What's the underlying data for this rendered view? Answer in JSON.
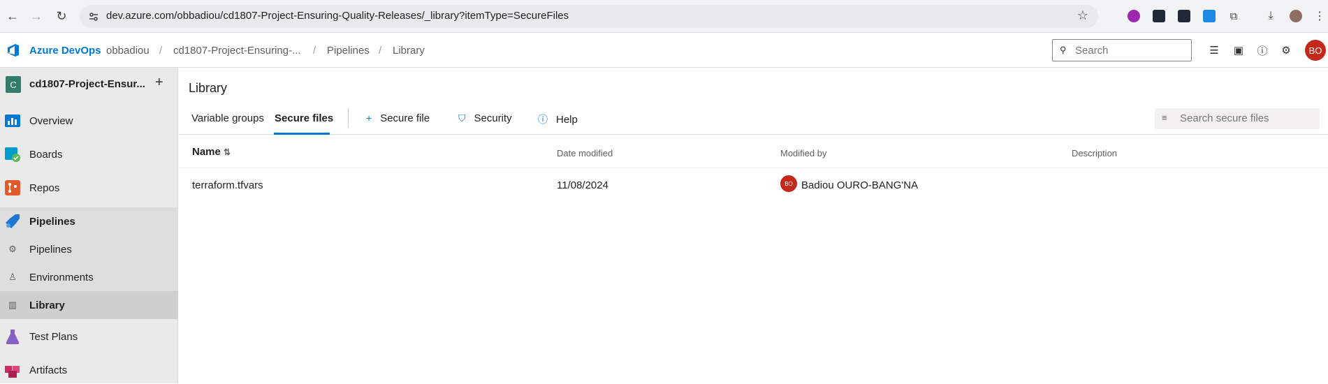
{
  "browser": {
    "url": "dev.azure.com/obbadiou/cd1807-Project-Ensuring-Quality-Releases/_library?itemType=SecureFiles"
  },
  "header": {
    "brand": "Azure DevOps",
    "breadcrumb": [
      "obbadiou",
      "cd1807-Project-Ensuring-...",
      "Pipelines",
      "Library"
    ],
    "search_placeholder": "Search",
    "user_initials": "BO"
  },
  "sidebar": {
    "project_initial": "C",
    "project_name": "cd1807-Project-Ensur...",
    "items": [
      {
        "label": "Overview",
        "icon": "overview-icon",
        "color": "#0078d4"
      },
      {
        "label": "Boards",
        "icon": "boards-icon",
        "color": "#009ccc"
      },
      {
        "label": "Repos",
        "icon": "repos-icon",
        "color": "#e05a2b"
      },
      {
        "label": "Pipelines",
        "icon": "pipelines-icon",
        "color": "#1e77d3"
      },
      {
        "label": "Pipelines",
        "icon": "pipeline-sub-icon"
      },
      {
        "label": "Environments",
        "icon": "environments-icon"
      },
      {
        "label": "Library",
        "icon": "library-icon"
      },
      {
        "label": "Test Plans",
        "icon": "test-plans-icon",
        "color": "#8661c5"
      },
      {
        "label": "Artifacts",
        "icon": "artifacts-icon",
        "color": "#cc2a64"
      }
    ]
  },
  "main": {
    "title": "Library",
    "tabs": [
      {
        "label": "Variable groups",
        "active": false
      },
      {
        "label": "Secure files",
        "active": true
      }
    ],
    "commands": [
      {
        "label": "Secure file",
        "icon": "plus-icon"
      },
      {
        "label": "Security",
        "icon": "shield-icon"
      },
      {
        "label": "Help",
        "icon": "help-icon"
      }
    ],
    "filter_placeholder": "Search secure files",
    "columns": [
      "Name",
      "Date modified",
      "Modified by",
      "Description"
    ],
    "rows": [
      {
        "name": "terraform.tfvars",
        "date": "11/08/2024",
        "modified_by": "Badiou OURO-BANG'NA",
        "initials": "BO",
        "description": ""
      }
    ]
  },
  "colors": {
    "accent": "#0078d4",
    "avatar": "#c4281b"
  }
}
